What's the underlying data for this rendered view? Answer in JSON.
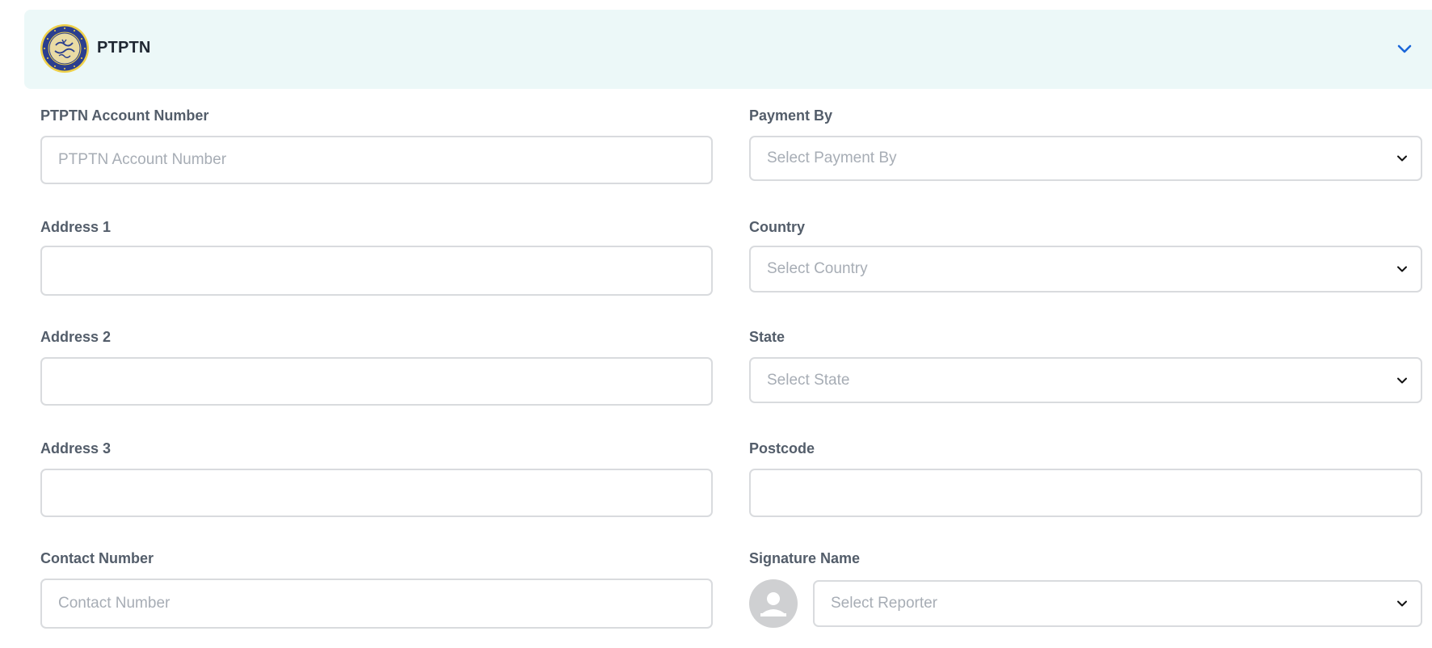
{
  "header": {
    "title": "PTPTN",
    "logo_icon": "ptptn-seal-logo",
    "toggle_icon": "chevron-down-icon",
    "background_color": "#ecf8f8",
    "accent_color": "#1a66d9"
  },
  "form": {
    "left": [
      {
        "label": "PTPTN Account Number",
        "placeholder": "PTPTN Account Number",
        "value": ""
      },
      {
        "label": "Address 1",
        "placeholder": "",
        "value": ""
      },
      {
        "label": "Address 2",
        "placeholder": "",
        "value": ""
      },
      {
        "label": "Address 3",
        "placeholder": "",
        "value": ""
      },
      {
        "label": "Contact Number",
        "placeholder": "Contact Number",
        "value": ""
      }
    ],
    "right": {
      "payment_by": {
        "label": "Payment By",
        "placeholder": "Select Payment By"
      },
      "country": {
        "label": "Country",
        "placeholder": "Select Country"
      },
      "state": {
        "label": "State",
        "placeholder": "Select State"
      },
      "postcode": {
        "label": "Postcode",
        "placeholder": "",
        "value": ""
      },
      "signature": {
        "label": "Signature Name",
        "placeholder": "Select Reporter",
        "avatar_icon": "user-avatar-icon"
      }
    }
  }
}
